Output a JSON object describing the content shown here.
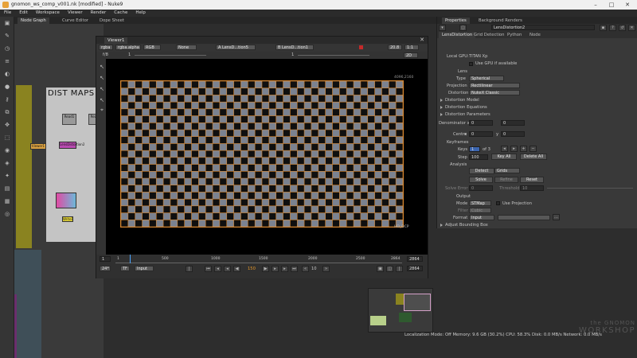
{
  "window": {
    "title": "gnomon_ws_comp_v001.nk [modified] - Nuke9"
  },
  "menu": [
    "File",
    "Edit",
    "Workspace",
    "Viewer",
    "Render",
    "Cache",
    "Help"
  ],
  "left_tabs": [
    "Node Graph",
    "Curve Editor",
    "Dope Sheet"
  ],
  "node_graph": {
    "backdrop_label": "DIST MAPS",
    "nodes": [
      "Read1",
      "Read2",
      "LensDistortion2",
      "Write1",
      "Viewer1"
    ]
  },
  "viewer": {
    "tab": "Viewer1",
    "channels": "rgba",
    "alpha": "rgba.alpha",
    "colorspace": "RGB",
    "overlay": "None",
    "input_a": "A  LensD...tion5",
    "input_b": "B  LensD...tion1",
    "zoom": "20.8",
    "ratio": "1:1",
    "gain": "f/8",
    "gain_value": "1",
    "gamma_value": "1",
    "mode": "2D",
    "format_label": "HD_DCP",
    "corner_label": "4096,2160",
    "timeline": {
      "ticks": [
        "1",
        "500",
        "1000",
        "1500",
        "2000",
        "2500",
        "2864"
      ],
      "start": "1",
      "end": "2864",
      "current": "150",
      "fps": "24*",
      "tf": "TF",
      "input": "Input",
      "step": "10"
    }
  },
  "properties": {
    "tabs": [
      "Properties",
      "Background Renders"
    ],
    "node_name": "LensDistortion2",
    "subtabs": [
      "LensDistortion",
      "Grid Detection",
      "Python",
      "Node"
    ],
    "local_gpu_label": "Local GPU:",
    "local_gpu_value": "TITAN Xp",
    "use_gpu": "Use GPU if available",
    "lens_label": "Lens",
    "type_label": "Type",
    "type_value": "Spherical",
    "projection_label": "Projection",
    "projection_value": "Rectilinear",
    "distortion_label": "Distortion",
    "distortion_value": "NukeX Classic",
    "sections": [
      "Distortion Model",
      "Distortion Equations",
      "Distortion Parameters"
    ],
    "denominator_label": "Denominator x",
    "denominator_x": "0",
    "denominator_y": "0",
    "centre_label": "Centre",
    "centre_x_label": "x",
    "centre_x": "0",
    "centre_y_label": "y",
    "centre_y": "0",
    "keyframes_label": "Keyframes",
    "keys_label": "Keys",
    "keys_value": "1",
    "keys_of": "of 3",
    "step_label": "Step",
    "step_value": "100",
    "key_all": "Key All",
    "delete_all": "Delete All",
    "analysis_label": "Analysis",
    "detect": "Detect",
    "grids": "Grids",
    "solve": "Solve",
    "refine": "Refine",
    "reset": "Reset",
    "solve_error_label": "Solve Error",
    "solve_error_value": "0",
    "threshold_label": "Threshold",
    "threshold_value": "10",
    "output_label": "Output",
    "mode_label": "Mode",
    "mode_value": "STMap",
    "use_projection": "Use Projection",
    "filter_label": "Filter",
    "filter_value": "Cubic",
    "format_label": "Format",
    "format_value": "Input",
    "adjust_bbox": "Adjust Bounding Box"
  },
  "status_bar": "Localization Mode: Off  Memory: 9.6 GB (30.2%)  CPU: 58.3%  Disk: 0.0 MB/s  Network: 0.0 MB/s",
  "watermark": {
    "line1": "the GNOMON",
    "line2": "WORKSHOP"
  },
  "colors": {
    "accent": "#e89a2a",
    "checker_dark": "#0f0f0f",
    "checker_light": "#7b8290",
    "grid_line": "#d6862f",
    "nodegraph_bg": "#3a3a3a",
    "backdrop": "#c4c4c4",
    "yellow_strip": "#8a8320",
    "purple_strip": "#6b2e6d"
  }
}
